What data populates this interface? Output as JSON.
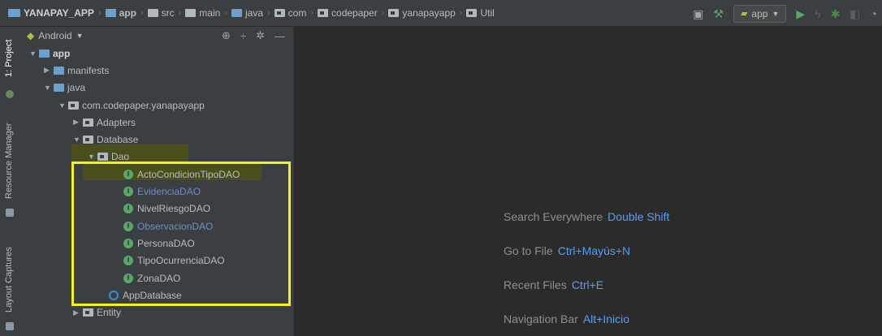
{
  "breadcrumb": {
    "items": [
      "YANAPAY_APP",
      "app",
      "src",
      "main",
      "java",
      "com",
      "codepaper",
      "yanapayapp",
      "Util"
    ]
  },
  "toolbar": {
    "run_config": "app",
    "icons": [
      "device-icon",
      "hammer-icon",
      "android-icon",
      "dropdown-icon",
      "run-icon",
      "apply-changes-icon",
      "debug-icon",
      "profile-icon",
      "attach-icon"
    ]
  },
  "side_strip": {
    "project": "1: Project",
    "resource_manager": "Resource Manager",
    "layout_captures": "Layout Captures"
  },
  "panel": {
    "view_mode": "Android"
  },
  "tree": {
    "app": "app",
    "manifests": "manifests",
    "java": "java",
    "package": "com.codepaper.yanapayapp",
    "adapters": "Adapters",
    "database": "Database",
    "dao": "Dao",
    "dao_items": [
      {
        "label": "ActoCondicionTipoDAO",
        "color": "#bbbbbb"
      },
      {
        "label": "EvidenciaDAO",
        "color": "#6c8fc6"
      },
      {
        "label": "NivelRiesgoDAO",
        "color": "#bbbbbb"
      },
      {
        "label": "ObservacionDAO",
        "color": "#6c8fc6"
      },
      {
        "label": "PersonaDAO",
        "color": "#bbbbbb"
      },
      {
        "label": "TipoOcurrenciaDAO",
        "color": "#bbbbbb"
      },
      {
        "label": "ZonaDAO",
        "color": "#bbbbbb"
      }
    ],
    "app_database": "AppDatabase",
    "entity": "Entity"
  },
  "hints": [
    {
      "text": "Search Everywhere",
      "key": "Double Shift"
    },
    {
      "text": "Go to File",
      "key": "Ctrl+Mayús+N"
    },
    {
      "text": "Recent Files",
      "key": "Ctrl+E"
    },
    {
      "text": "Navigation Bar",
      "key": "Alt+Inicio"
    }
  ],
  "colors": {
    "highlight": "#f5f21b",
    "link_key": "#589df6",
    "interface_icon": "#59a869"
  }
}
